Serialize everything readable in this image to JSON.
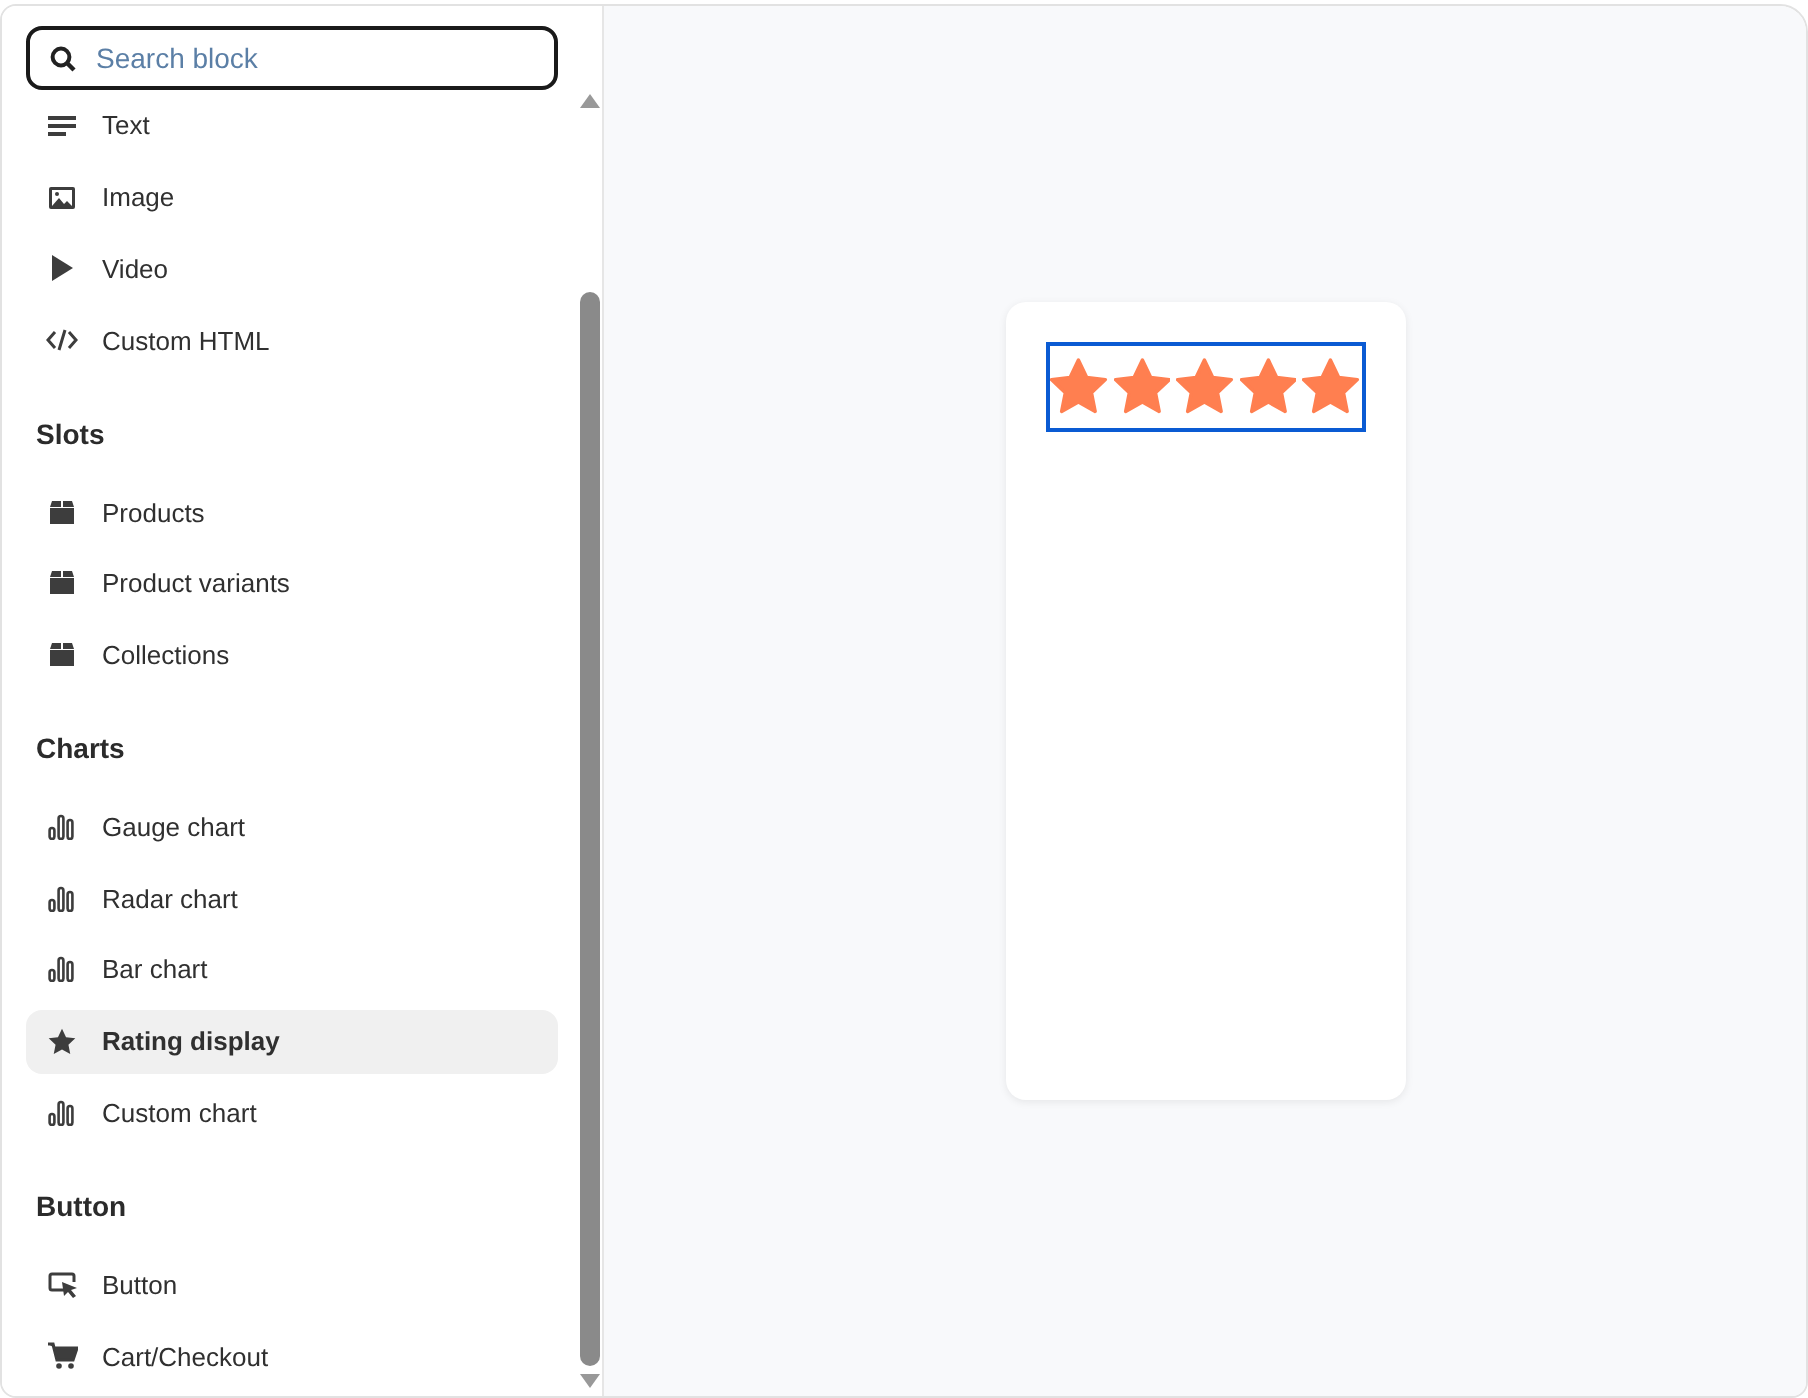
{
  "search": {
    "placeholder": "Search block"
  },
  "sections": [
    {
      "items": [
        {
          "label": "Text",
          "kind": "text",
          "selected": false
        },
        {
          "label": "Image",
          "kind": "image",
          "selected": false
        },
        {
          "label": "Video",
          "kind": "video",
          "selected": false
        },
        {
          "label": "Custom HTML",
          "kind": "code",
          "selected": false
        }
      ]
    },
    {
      "title": "Slots",
      "items": [
        {
          "label": "Products",
          "kind": "box",
          "selected": false
        },
        {
          "label": "Product variants",
          "kind": "box",
          "selected": false
        },
        {
          "label": "Collections",
          "kind": "box",
          "selected": false
        }
      ]
    },
    {
      "title": "Charts",
      "items": [
        {
          "label": "Gauge chart",
          "kind": "chart",
          "selected": false
        },
        {
          "label": "Radar chart",
          "kind": "chart",
          "selected": false
        },
        {
          "label": "Bar chart",
          "kind": "chart",
          "selected": false
        },
        {
          "label": "Rating display",
          "kind": "star",
          "selected": true
        },
        {
          "label": "Custom chart",
          "kind": "chart",
          "selected": false
        }
      ]
    },
    {
      "title": "Button",
      "items": [
        {
          "label": "Button",
          "kind": "cursor",
          "selected": false
        },
        {
          "label": "Cart/Checkout",
          "kind": "cart",
          "selected": false
        }
      ]
    }
  ],
  "preview": {
    "rating": {
      "stars": 5,
      "selected": true
    }
  }
}
